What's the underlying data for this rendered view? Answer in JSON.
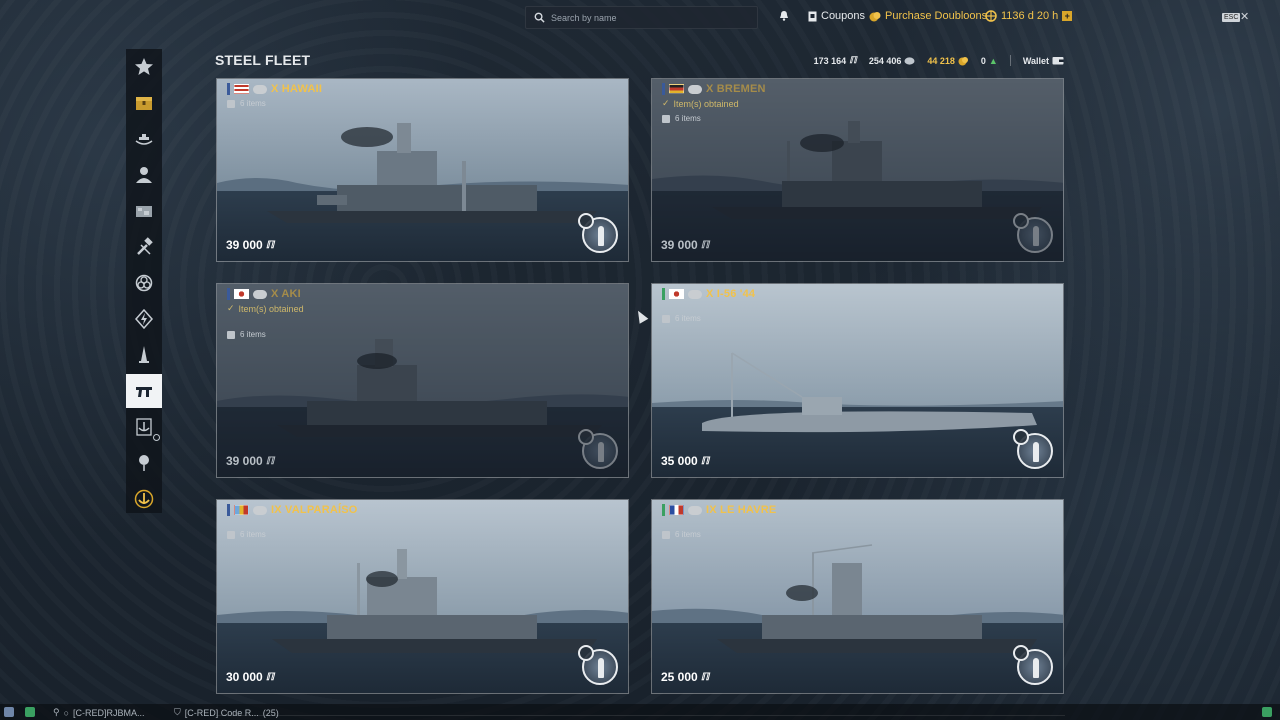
{
  "topbar": {
    "search_placeholder": "Search by name",
    "notifications_icon": "bell-icon",
    "coupons_label": "Coupons",
    "purchase_label": "Purchase Doubloons",
    "premium_time": "1136 d 20 h",
    "esc_label": "ESC",
    "close_label": "✕"
  },
  "header": {
    "title": "STEEL FLEET",
    "resources": [
      {
        "value": "173 164",
        "icon": "steel-icon"
      },
      {
        "value": "254 406",
        "icon": "coal-icon"
      },
      {
        "value": "44 218",
        "icon": "doubloons-icon"
      },
      {
        "value": "0",
        "icon": "exp-icon"
      }
    ],
    "wallet_label": "Wallet"
  },
  "sidebar": {
    "items": [
      {
        "name": "featured-icon",
        "active": false
      },
      {
        "name": "containers-icon",
        "active": false
      },
      {
        "name": "ships-icon",
        "active": false
      },
      {
        "name": "commanders-icon",
        "active": false
      },
      {
        "name": "camouflage-icon",
        "active": false
      },
      {
        "name": "upgrades-icon",
        "active": false
      },
      {
        "name": "signals-icon",
        "active": false
      },
      {
        "name": "boosters-icon",
        "active": false
      },
      {
        "name": "research-icon",
        "active": false
      },
      {
        "name": "steel-icon",
        "active": true
      },
      {
        "name": "clan-icon",
        "active": false
      },
      {
        "name": "ranked-icon",
        "active": false
      },
      {
        "name": "anchor-icon",
        "active": false
      }
    ]
  },
  "cards": [
    {
      "name": "X HAWAII",
      "items": "6 items",
      "obtained": "",
      "price": "39 000",
      "dim": false,
      "flag": "usa"
    },
    {
      "name": "X BREMEN",
      "items": "6 items",
      "obtained": "Item(s) obtained",
      "price": "39 000",
      "dim": true,
      "flag": "germany"
    },
    {
      "name": "X AKI",
      "items": "6 items",
      "obtained": "Item(s) obtained",
      "price": "39 000",
      "dim": true,
      "flag": "japan"
    },
    {
      "name": "X I-56 '44",
      "items": "6 items",
      "obtained": "",
      "price": "35 000",
      "dim": false,
      "flag": "japan"
    },
    {
      "name": "IX VALPARAÍSO",
      "items": "6 items",
      "obtained": "",
      "price": "30 000",
      "dim": false,
      "flag": "panamerica"
    },
    {
      "name": "IX LE HAVRE",
      "items": "6 items",
      "obtained": "",
      "price": "25 000",
      "dim": false,
      "flag": "france"
    }
  ],
  "bottombar": {
    "player": "[C-RED]RJBMA...",
    "clan_chat": "[C-RED] Code R...",
    "clan_count": "(25)"
  }
}
